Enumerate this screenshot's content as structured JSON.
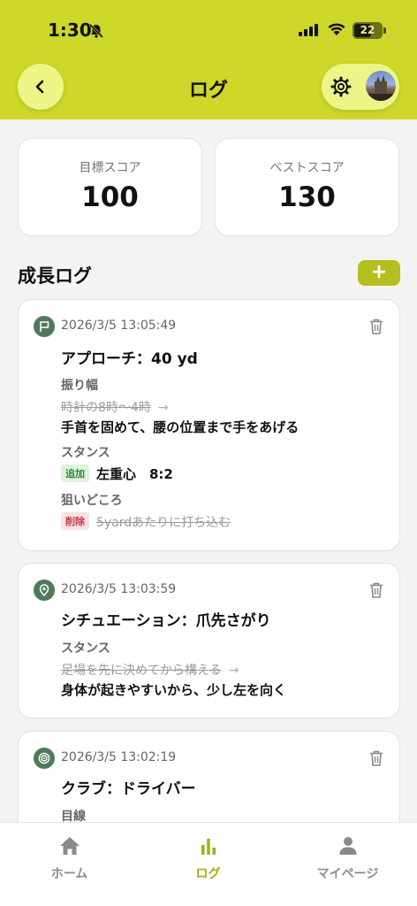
{
  "status_bar": {
    "time": "1:30",
    "battery": "22"
  },
  "header": {
    "title": "ログ"
  },
  "scores": [
    {
      "label": "目標スコア",
      "value": "100"
    },
    {
      "label": "ベストスコア",
      "value": "130"
    }
  ],
  "section": {
    "title": "成長ログ",
    "add_label": "+"
  },
  "logs": [
    {
      "date": "2026/3/5 13:05:49",
      "icon": "flag-icon",
      "title": "アプローチ：40 yd",
      "fields": [
        {
          "label": "振り幅",
          "old": "時計の8時〜4時",
          "new": "手首を固めて、腰の位置まで手をあげる"
        },
        {
          "label": "スタンス",
          "tag": "追加",
          "value": "左重心　8:2"
        },
        {
          "label": "狙いどころ",
          "tag": "削除",
          "value": "5yardあたりに打ち込む"
        }
      ]
    },
    {
      "date": "2026/3/5 13:03:59",
      "icon": "location-pin-icon",
      "title": "シチュエーション：爪先さがり",
      "fields": [
        {
          "label": "スタンス",
          "old": "足場を先に決めてから構える",
          "new": "身体が起きやすいから、少し左を向く"
        }
      ]
    },
    {
      "date": "2026/3/5 13:02:19",
      "icon": "target-icon",
      "title": "クラブ：ドライバー",
      "fields": [
        {
          "label": "目線"
        }
      ]
    }
  ],
  "tabs": [
    {
      "label": "ホーム",
      "icon": "home-icon"
    },
    {
      "label": "ログ",
      "icon": "bar-chart-icon"
    },
    {
      "label": "マイページ",
      "icon": "person-icon"
    }
  ],
  "colors": {
    "accent": "#cdd82a",
    "accent_dark": "#b6bf20",
    "icon_green": "#4e7a5a",
    "tag_add": "#2f8a3a",
    "tag_delete": "#c93744"
  }
}
